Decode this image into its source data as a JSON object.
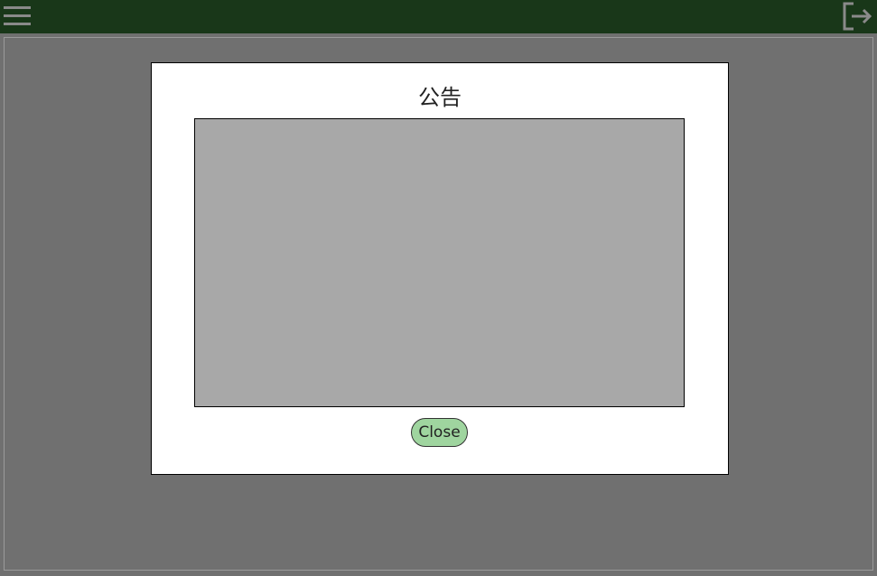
{
  "topbar": {
    "background_color": "#193719",
    "menu_icon": "hamburger-menu-icon",
    "logout_icon": "logout-icon"
  },
  "modal": {
    "title": "公告",
    "close_label": "Close",
    "close_button_color": "#9fd59f",
    "content_box_color": "#a8a8a8"
  }
}
